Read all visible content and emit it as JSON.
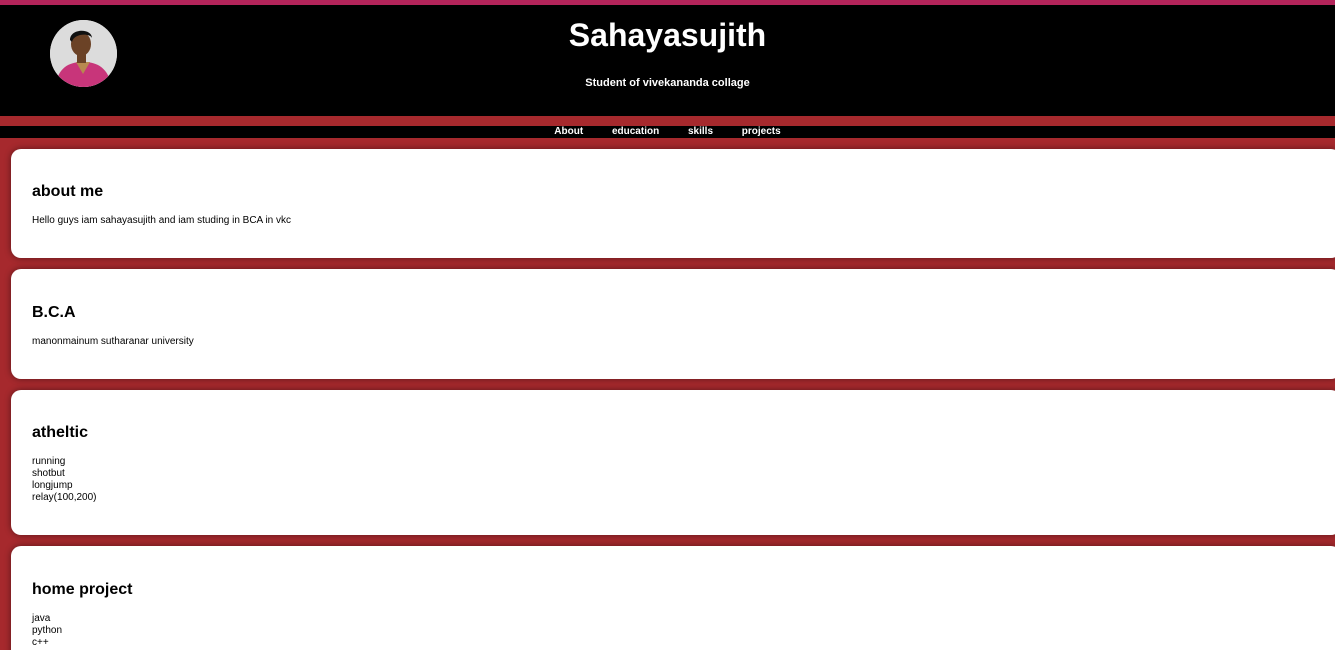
{
  "header": {
    "title": "Sahayasujith",
    "subtitle": "Student of vivekananda collage"
  },
  "nav": {
    "items": [
      "About",
      "education",
      "skills",
      "projects"
    ]
  },
  "sections": {
    "about": {
      "heading": "about me",
      "text": "Hello guys iam sahayasujith and iam studing in BCA in vkc"
    },
    "education": {
      "heading": "B.C.A",
      "text": "manonmainum sutharanar university"
    },
    "skills": {
      "heading": "atheltic",
      "items": [
        "running",
        "shotbut",
        "longjump",
        "relay(100,200)"
      ]
    },
    "projects": {
      "heading": "home project",
      "items": [
        "java",
        "python",
        "c++"
      ]
    }
  },
  "colors": {
    "background": "#a6292d",
    "header_bg": "#000000",
    "top_accent": "#b3245a",
    "card_bg": "#ffffff"
  }
}
